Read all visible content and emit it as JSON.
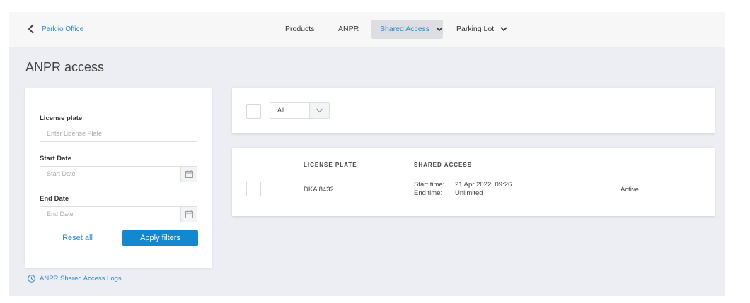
{
  "header": {
    "back_label": "Parklio Office",
    "nav": [
      {
        "label": "Products",
        "active": false,
        "dropdown": false
      },
      {
        "label": "ANPR",
        "active": false,
        "dropdown": false
      },
      {
        "label": "Shared Access",
        "active": true,
        "dropdown": true
      },
      {
        "label": "Parking Lot",
        "active": false,
        "dropdown": true
      }
    ]
  },
  "page": {
    "title": "ANPR access"
  },
  "filters": {
    "license_plate_label": "License plate",
    "license_plate_placeholder": "Enter License Plate",
    "start_date_label": "Start Date",
    "start_date_placeholder": "Start Date",
    "end_date_label": "End Date",
    "end_date_placeholder": "End Date",
    "reset_label": "Reset all",
    "apply_label": "Apply filters"
  },
  "logs_link": "ANPR Shared Access Logs",
  "toolbar": {
    "select_value": "All"
  },
  "table": {
    "columns": [
      "LICENSE PLATE",
      "SHARED ACCESS"
    ],
    "rows": [
      {
        "license_plate": "DKA 8432",
        "start_label": "Start time:",
        "start_value": "21 Apr 2022, 09:26",
        "end_label": "End time:",
        "end_value": "Unlimited",
        "status": "Active"
      }
    ]
  },
  "colors": {
    "accent": "#1388d0",
    "link": "#2e8bc6",
    "background": "#eceef3"
  },
  "icons": [
    "chevron-left-icon",
    "chevron-down-icon",
    "calendar-icon",
    "clock-icon"
  ]
}
